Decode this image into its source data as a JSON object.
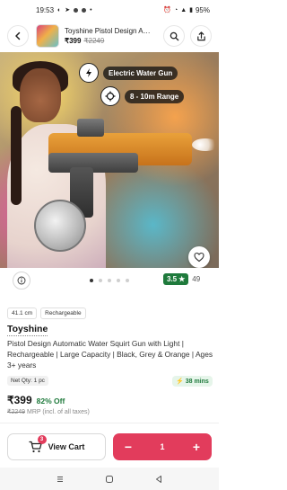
{
  "status_bar": {
    "time": "19:53",
    "battery": "95%"
  },
  "header": {
    "title": "Toyshine Pistol Design Aut...",
    "price": "₹399",
    "mrp": "₹2249"
  },
  "hero": {
    "feature_1": "Electric Water Gun",
    "feature_2": "8 - 10m Range"
  },
  "carousel": {
    "total_images": 5,
    "active_index": 0
  },
  "rating": {
    "value": "3.5",
    "count": "49"
  },
  "tags": [
    "41.1 cm",
    "Rechargeable"
  ],
  "product": {
    "brand": "Toyshine",
    "description": "Pistol Design Automatic Water Squirt Gun with Light | Rechargeable | Large Capacity | Black, Grey & Orange | Ages 3+ years",
    "net_qty": "Net Qty: 1 pc",
    "delivery_time": "38 mins",
    "price": "₹399",
    "discount": "82% Off",
    "mrp": "₹2249",
    "mrp_suffix": "MRP (incl. of all taxes)"
  },
  "cart": {
    "view_cart_label": "View Cart",
    "cart_count": "3",
    "quantity": "1",
    "minus_label": "−",
    "plus_label": "+"
  },
  "colors": {
    "accent": "#e23c5c",
    "rating_green": "#1f7a3c",
    "discount_green": "#1f7a3c"
  }
}
